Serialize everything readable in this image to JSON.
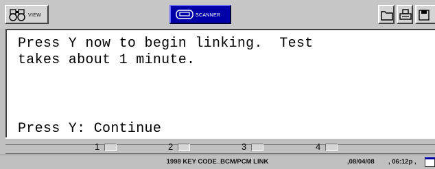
{
  "toolbar": {
    "view_label": "VIEW",
    "scanner_label": "SCANNER"
  },
  "main": {
    "line1": "Press Y now to begin linking.  Test",
    "line2": "takes about 1 minute.",
    "line3": "Press Y: Continue"
  },
  "function_keys": [
    "1",
    "2",
    "3",
    "4"
  ],
  "status": {
    "title": "1998 KEY CODE_BCM/PCM LINK",
    "date": ",08/04/08",
    "time": ", 06:12p ,"
  },
  "icons": {
    "view": "binoculars-icon",
    "scanner": "scanner-icon",
    "folder": "folder-icon",
    "print": "printer-icon",
    "save": "save-icon",
    "calendar": "calendar-icon"
  }
}
